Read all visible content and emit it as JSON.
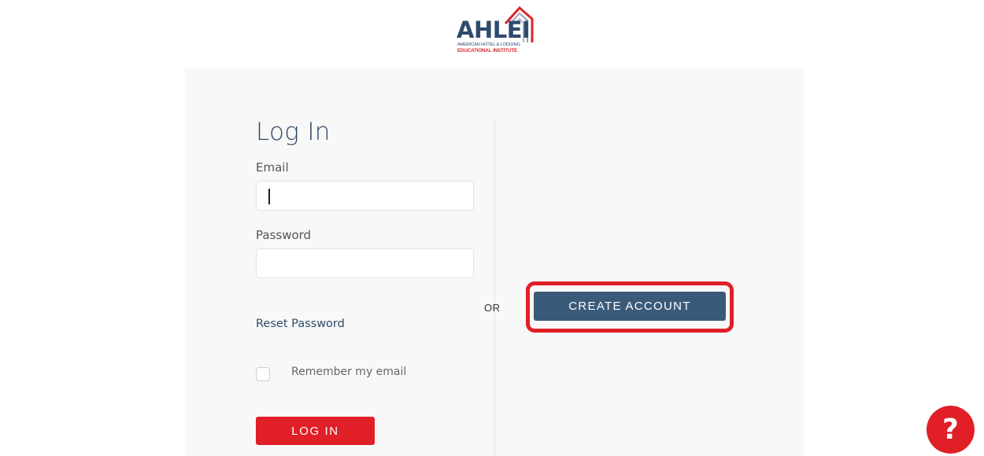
{
  "logo": {
    "word": "AHLEI",
    "line1": "AMERICAN HOTEL & LODGING",
    "line2": "EDUCATIONAL INSTITUTE"
  },
  "login": {
    "title": "Log In",
    "email_label": "Email",
    "email_value": "",
    "password_label": "Password",
    "password_value": "",
    "reset_link": "Reset Password",
    "remember_label": "Remember my email",
    "remember_checked": false,
    "submit_label": "LOG IN"
  },
  "separator": "OR",
  "create_account": {
    "label": "CREATE ACCOUNT"
  },
  "help": {
    "label": "?"
  },
  "colors": {
    "brand_red": "#e01f26",
    "brand_navy": "#2e4a6e",
    "button_blue": "#3a5a7a",
    "panel_bg": "#f8f8f8"
  }
}
